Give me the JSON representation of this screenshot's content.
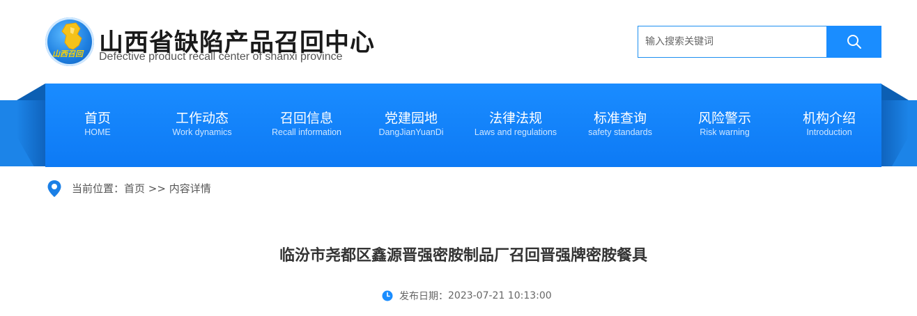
{
  "header": {
    "logo_text": "山西召回",
    "title": "山西省缺陷产品召回中心",
    "subtitle": "Defective product recall center of shanxi province"
  },
  "search": {
    "placeholder": "输入搜索关键词",
    "icon": "search-icon"
  },
  "nav": {
    "items": [
      {
        "cn": "首页",
        "en": "HOME"
      },
      {
        "cn": "工作动态",
        "en": "Work dynamics"
      },
      {
        "cn": "召回信息",
        "en": "Recall information"
      },
      {
        "cn": "党建园地",
        "en": "DangJianYuanDi"
      },
      {
        "cn": "法律法规",
        "en": "Laws and regulations"
      },
      {
        "cn": "标准查询",
        "en": "safety standards"
      },
      {
        "cn": "风险警示",
        "en": "Risk warning"
      },
      {
        "cn": "机构介绍",
        "en": "Introduction"
      }
    ]
  },
  "breadcrumb": {
    "prefix": "当前位置：",
    "home": "首页",
    "separator": " >> ",
    "current": "内容详情",
    "icon": "location-pin-icon"
  },
  "article": {
    "title": "临汾市尧都区鑫源晋强密胺制品厂召回晋强牌密胺餐具",
    "publish_label": "发布日期：",
    "publish_date": "2023-07-21 10:13:00",
    "clock_icon": "clock-icon"
  },
  "colors": {
    "primary": "#1a8dff",
    "nav_bg": "#0d7af5",
    "band": "#1577d6",
    "text": "#333333"
  }
}
